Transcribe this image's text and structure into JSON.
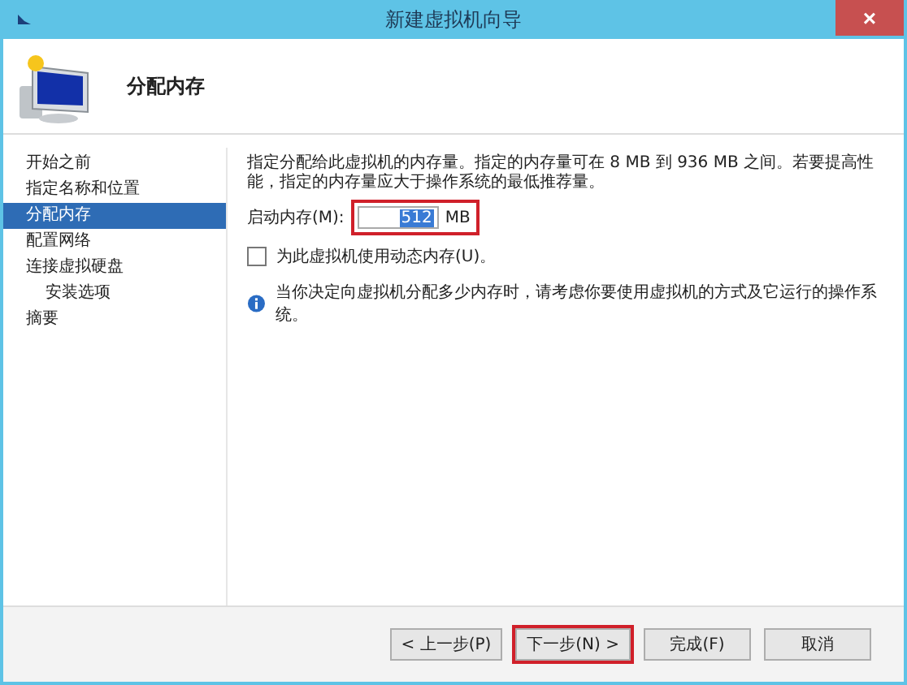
{
  "window": {
    "title": "新建虚拟机向导",
    "close": "×"
  },
  "header": {
    "title": "分配内存"
  },
  "steps": [
    {
      "label": "开始之前",
      "selected": false
    },
    {
      "label": "指定名称和位置",
      "selected": false
    },
    {
      "label": "分配内存",
      "selected": true
    },
    {
      "label": "配置网络",
      "selected": false
    },
    {
      "label": "连接虚拟硬盘",
      "selected": false,
      "children": [
        {
          "label": "安装选项",
          "selected": false
        }
      ]
    },
    {
      "label": "摘要",
      "selected": false
    }
  ],
  "description": "指定分配给此虚拟机的内存量。指定的内存量可在 8 MB 到 936 MB 之间。若要提高性能，指定的内存量应大于操作系统的最低推荐量。",
  "startup_memory": {
    "label": "启动内存(M):",
    "value": "512",
    "unit": "MB",
    "highlighted": true
  },
  "dynamic_memory": {
    "label": "为此虚拟机使用动态内存(U)。",
    "checked": false
  },
  "info": "当你决定向虚拟机分配多少内存时，请考虑你要使用虚拟机的方式及它运行的操作系统。",
  "buttons": [
    {
      "label": "< 上一步(P)",
      "highlighted": false
    },
    {
      "label": "下一步(N) >",
      "highlighted": true
    },
    {
      "label": "完成(F)",
      "highlighted": false
    },
    {
      "label": "取消",
      "highlighted": false
    }
  ]
}
